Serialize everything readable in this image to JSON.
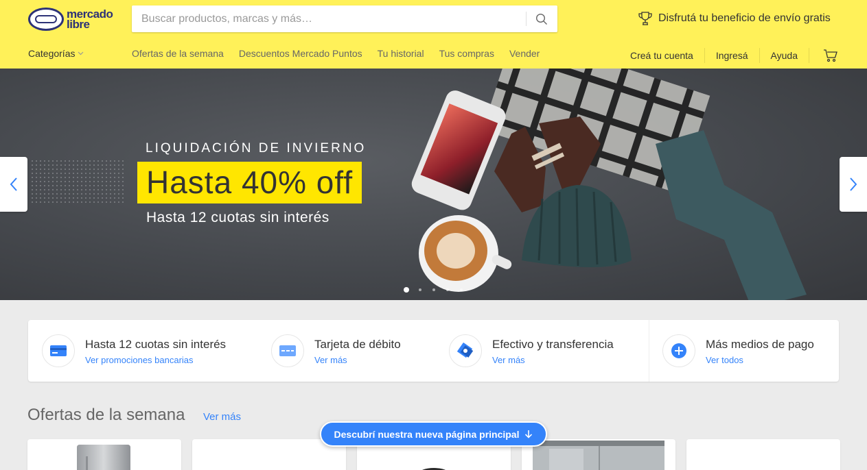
{
  "brand": {
    "name_line1": "mercado",
    "name_line2": "libre",
    "color_primary": "#fff159",
    "color_logo": "#2d3277"
  },
  "search": {
    "placeholder": "Buscar productos, marcas y más…",
    "icon": "search-icon"
  },
  "promo_banner": {
    "text": "Disfrutá tu beneficio de envío gratis",
    "icon": "trophy-icon"
  },
  "nav": {
    "categories_label": "Categorías",
    "links": [
      "Ofertas de la semana",
      "Descuentos Mercado Puntos",
      "Tu historial",
      "Tus compras",
      "Vender"
    ],
    "account": {
      "create": "Creá tu cuenta",
      "login": "Ingresá",
      "help": "Ayuda",
      "cart_icon": "cart-icon"
    }
  },
  "hero": {
    "kicker": "LIQUIDACIÓN DE INVIERNO",
    "title": "Hasta 40% off",
    "subtitle": "Hasta 12 cuotas sin interés",
    "highlight_color": "#ffe600",
    "slides_total": 5,
    "active_slide": 1
  },
  "payments": [
    {
      "title": "Hasta 12 cuotas sin interés",
      "link": "Ver promociones bancarias",
      "icon": "credit-card-icon"
    },
    {
      "title": "Tarjeta de débito",
      "link": "Ver más",
      "icon": "debit-card-icon"
    },
    {
      "title": "Efectivo y transferencia",
      "link": "Ver más",
      "icon": "cash-icon"
    },
    {
      "title": "Más medios de pago",
      "link": "Ver todos",
      "icon": "plus-icon"
    }
  ],
  "offers": {
    "title": "Ofertas de la semana",
    "more": "Ver más"
  },
  "discover_button": {
    "label": "Descubrí nuestra nueva página principal",
    "icon": "arrow-down-icon"
  },
  "accent_color": "#3483fa"
}
